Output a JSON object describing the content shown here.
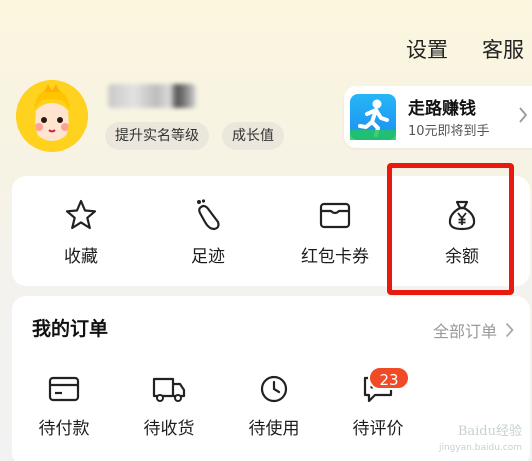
{
  "header": {
    "settings_label": "设置",
    "service_label": "客服"
  },
  "profile": {
    "tag_verify": "提升实名等级",
    "tag_growth": "成长值"
  },
  "promo": {
    "title": "走路赚钱",
    "subtitle": "10元即将到手"
  },
  "assets": {
    "items": [
      {
        "label": "收藏",
        "icon": "star-icon"
      },
      {
        "label": "足迹",
        "icon": "footprint-icon"
      },
      {
        "label": "红包卡券",
        "icon": "wallet-icon"
      },
      {
        "label": "余额",
        "icon": "money-bag-icon"
      }
    ],
    "highlight_color": "#e8190f"
  },
  "orders": {
    "title": "我的订单",
    "all_label": "全部订单",
    "items": [
      {
        "label": "待付款",
        "icon": "card-icon"
      },
      {
        "label": "待收货",
        "icon": "truck-icon"
      },
      {
        "label": "待使用",
        "icon": "clock-icon"
      },
      {
        "label": "待评价",
        "icon": "comment-icon"
      }
    ],
    "review_badge": "23"
  },
  "watermark": {
    "text": "Baidu经验",
    "url": "jingyan.baidu.com"
  }
}
